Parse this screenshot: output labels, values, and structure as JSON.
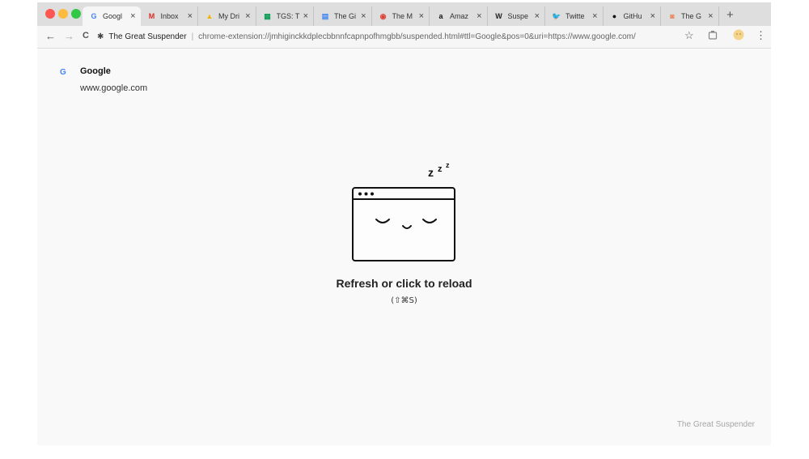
{
  "colors": {
    "close_dot": "#fc5753",
    "minimize_dot": "#fdbc40",
    "zoom_dot": "#33c748",
    "gmail_red": "#d93025",
    "sheets_green": "#0f9d58",
    "docs_blue": "#4285f4",
    "twitter_blue": "#1da1f2"
  },
  "tabs": [
    {
      "label": "Googl",
      "icon": "google-icon",
      "glyph": "G",
      "color": "#4285f4"
    },
    {
      "label": "Inbox",
      "icon": "gmail-icon",
      "glyph": "M",
      "color": "#d93025"
    },
    {
      "label": "My Dri",
      "icon": "drive-icon",
      "glyph": "▲",
      "color": "#f4b400"
    },
    {
      "label": "TGS: T",
      "icon": "sheets-icon",
      "glyph": "▦",
      "color": "#0f9d58"
    },
    {
      "label": "The Gi",
      "icon": "docs-icon",
      "glyph": "▤",
      "color": "#4285f4"
    },
    {
      "label": "The M",
      "icon": "chrome-icon",
      "glyph": "◉",
      "color": "#db4437"
    },
    {
      "label": "Amaz",
      "icon": "amazon-icon",
      "glyph": "a",
      "color": "#111111"
    },
    {
      "label": "Suspe",
      "icon": "wikipedia-icon",
      "glyph": "W",
      "color": "#222222"
    },
    {
      "label": "Twitte",
      "icon": "twitter-icon",
      "glyph": "🐦",
      "color": "#1da1f2"
    },
    {
      "label": "GitHu",
      "icon": "github-icon",
      "glyph": "●",
      "color": "#111111"
    },
    {
      "label": "The G",
      "icon": "suspender-icon",
      "glyph": "◙",
      "color": "#e8855a"
    }
  ],
  "toolbar": {
    "back_glyph": "←",
    "forward_glyph": "→",
    "reload_glyph": "C",
    "extension_glyph": "✱",
    "site_name": "The Great Suspender",
    "separator": "|",
    "url": "chrome-extension://jmhiginckkdplecbbnnfcapnpofhmgbb/suspended.html#ttl=Google&pos=0&uri=https://www.google.com/",
    "star_glyph": "☆",
    "menu_glyph": "⋮"
  },
  "page": {
    "favicon_glyph": "G",
    "site_title": "Google",
    "site_url": "www.google.com",
    "zzz": [
      "z",
      "z",
      "z"
    ],
    "reload_message": "Refresh or click to reload",
    "shortcut": "(⇧⌘S)",
    "footer_brand": "The Great Suspender"
  }
}
